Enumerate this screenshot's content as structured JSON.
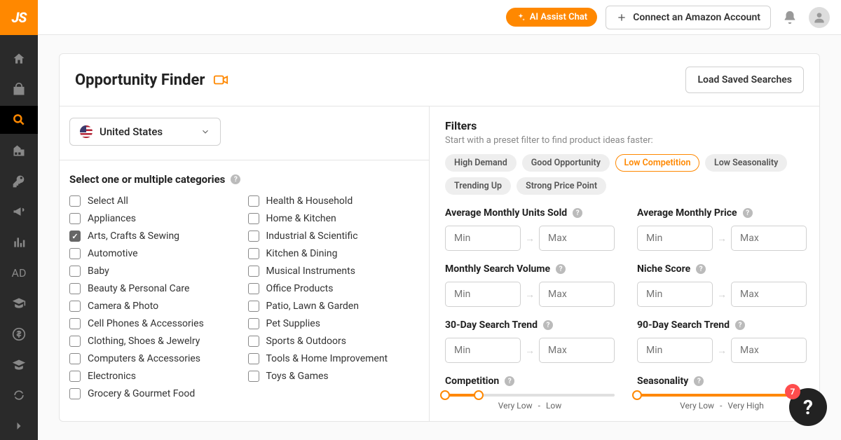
{
  "logo": "JS",
  "topbar": {
    "ai_chat": "AI Assist Chat",
    "connect": "Connect an Amazon Account"
  },
  "page_title": "Opportunity Finder",
  "load_saved": "Load Saved Searches",
  "country": "United States",
  "categories_heading": "Select one or multiple categories",
  "categories_col1": [
    {
      "label": "Select All",
      "checked": false
    },
    {
      "label": "Appliances",
      "checked": false
    },
    {
      "label": "Arts, Crafts & Sewing",
      "checked": true
    },
    {
      "label": "Automotive",
      "checked": false
    },
    {
      "label": "Baby",
      "checked": false
    },
    {
      "label": "Beauty & Personal Care",
      "checked": false
    },
    {
      "label": "Camera & Photo",
      "checked": false
    },
    {
      "label": "Cell Phones & Accessories",
      "checked": false
    },
    {
      "label": "Clothing, Shoes & Jewelry",
      "checked": false
    },
    {
      "label": "Computers & Accessories",
      "checked": false
    },
    {
      "label": "Electronics",
      "checked": false
    },
    {
      "label": "Grocery & Gourmet Food",
      "checked": false
    }
  ],
  "categories_col2": [
    {
      "label": "Health & Household",
      "checked": false
    },
    {
      "label": "Home & Kitchen",
      "checked": false
    },
    {
      "label": "Industrial & Scientific",
      "checked": false
    },
    {
      "label": "Kitchen & Dining",
      "checked": false
    },
    {
      "label": "Musical Instruments",
      "checked": false
    },
    {
      "label": "Office Products",
      "checked": false
    },
    {
      "label": "Patio, Lawn & Garden",
      "checked": false
    },
    {
      "label": "Pet Supplies",
      "checked": false
    },
    {
      "label": "Sports & Outdoors",
      "checked": false
    },
    {
      "label": "Tools & Home Improvement",
      "checked": false
    },
    {
      "label": "Toys & Games",
      "checked": false
    }
  ],
  "filters": {
    "title": "Filters",
    "subtitle": "Start with a preset filter to find product ideas faster:",
    "presets": [
      {
        "label": "High Demand",
        "active": false
      },
      {
        "label": "Good Opportunity",
        "active": false
      },
      {
        "label": "Low Competition",
        "active": true
      },
      {
        "label": "Low Seasonality",
        "active": false
      },
      {
        "label": "Trending Up",
        "active": false
      },
      {
        "label": "Strong Price Point",
        "active": false
      }
    ],
    "placeholders": {
      "min": "Min",
      "max": "Max"
    },
    "fields": {
      "avg_units": "Average Monthly Units Sold",
      "avg_price": "Average Monthly Price",
      "search_vol": "Monthly Search Volume",
      "niche": "Niche Score",
      "trend30": "30-Day Search Trend",
      "trend90": "90-Day Search Trend",
      "competition": "Competition",
      "seasonality": "Seasonality"
    },
    "competition_range": {
      "low": "Very Low",
      "sep": "-",
      "high": "Low",
      "fill_pct": 20,
      "thumb1": 0,
      "thumb2": 20
    },
    "seasonality_range": {
      "low": "Very Low",
      "sep": "-",
      "high": "Very High",
      "fill_pct": 100,
      "thumb1": 0,
      "thumb2": 100
    }
  },
  "help_badge": "7"
}
